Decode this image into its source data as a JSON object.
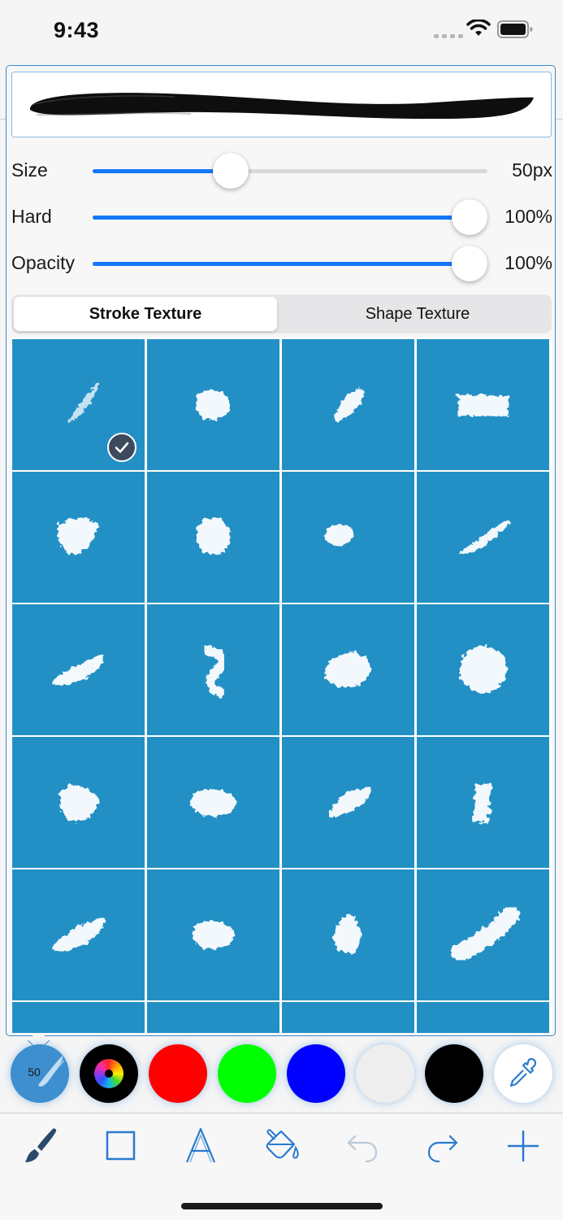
{
  "status": {
    "time": "9:43"
  },
  "sliders": [
    {
      "label": "Size",
      "value": "50px",
      "fraction": 0.35
    },
    {
      "label": "Hard",
      "value": "100%",
      "fraction": 0.955
    },
    {
      "label": "Opacity",
      "value": "100%",
      "fraction": 0.955
    }
  ],
  "segments": {
    "stroke": "Stroke Texture",
    "shape": "Shape Texture",
    "selected": "stroke"
  },
  "textures": {
    "selected_index": 0,
    "tile_color": "#2290c5",
    "items": [
      "brush-texture-1",
      "brush-texture-2",
      "brush-texture-3",
      "brush-texture-4",
      "brush-texture-5",
      "brush-texture-6",
      "brush-texture-7",
      "brush-texture-8",
      "brush-texture-9",
      "brush-texture-10",
      "brush-texture-11",
      "brush-texture-12",
      "brush-texture-13",
      "brush-texture-14",
      "brush-texture-15",
      "brush-texture-16",
      "brush-texture-17",
      "brush-texture-18",
      "brush-texture-19",
      "brush-texture-20"
    ]
  },
  "palette": {
    "brush_size": "50",
    "colors": [
      "#ff0000",
      "#00ff00",
      "#0000ff",
      "#eeeeee",
      "#000000"
    ],
    "accent": "#2a7ad0"
  },
  "toolbar": {
    "tools": [
      "paintbrush-icon",
      "rectangle-icon",
      "text-icon",
      "paint-bucket-icon",
      "undo-icon",
      "redo-icon",
      "add-icon"
    ]
  }
}
